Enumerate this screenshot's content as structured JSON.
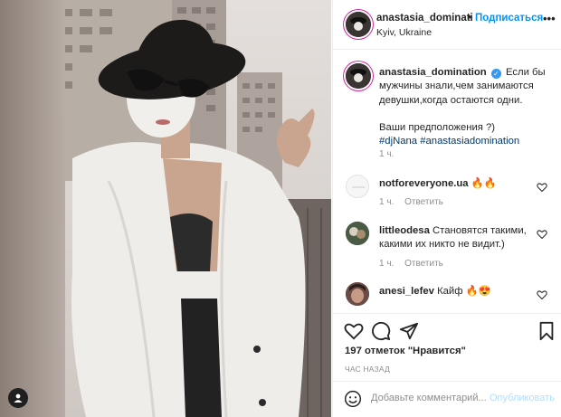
{
  "post": {
    "tag_icon": "user-tag-icon"
  },
  "header": {
    "username": "anastasia_dominati",
    "separator": "•",
    "follow_label": "Подписаться",
    "location": "Kyiv, Ukraine",
    "more_label": "•••"
  },
  "caption": {
    "username": "anastasia_domination",
    "verified_icon": "verified-badge-icon",
    "verified_mark": "✓",
    "text": "Если бы мужчины знали,чем занимаются девушки,когда остаются одни.",
    "text2": "Ваши предположения ?)",
    "hashtag1": "#djNana",
    "hashtag2": "#anastasiadomination",
    "time": "1 ч."
  },
  "comments": [
    {
      "username": "notforeveryone.ua",
      "text": "🔥🔥",
      "time": "1 ч.",
      "reply_label": "Ответить"
    },
    {
      "username": "littleodesa",
      "text": "Становятся такими, какими их никто не видит.)",
      "time": "1 ч.",
      "reply_label": "Ответить"
    },
    {
      "username": "anesi_lefev",
      "text": "Кайф 🔥😍",
      "time": "",
      "reply_label": ""
    }
  ],
  "actions": {
    "likes": "197 отметок \"Нравится\"",
    "post_time": "ЧАС НАЗАД",
    "icons": [
      "heart-icon",
      "comment-icon",
      "share-icon",
      "bookmark-icon"
    ]
  },
  "add_comment": {
    "placeholder": "Добавьте комментарий...",
    "publish_label": "Опубликовать"
  },
  "colors": {
    "accent": "#0095f6",
    "publish_disabled": "#b2dffc",
    "muted": "#8e8e8e",
    "hashtag": "#00376b"
  }
}
